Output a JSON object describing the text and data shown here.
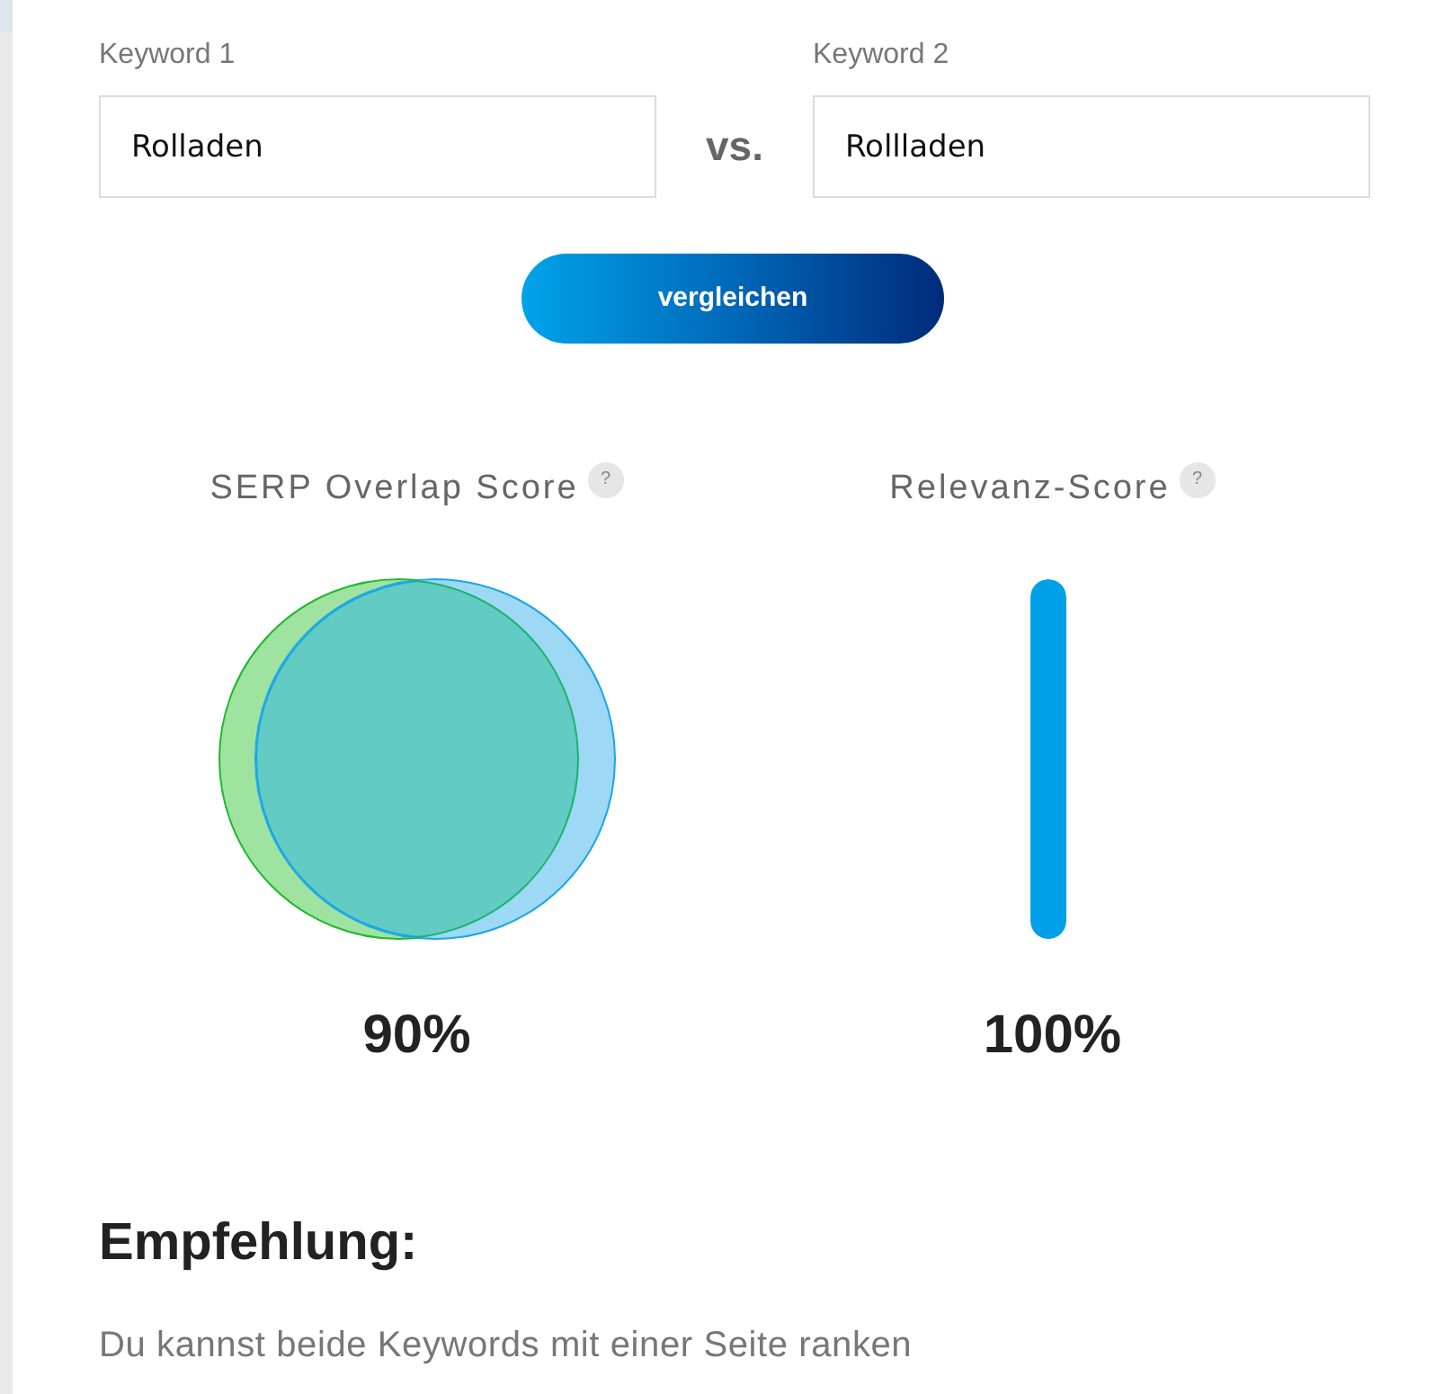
{
  "keyword_fields": [
    {
      "label": "Keyword 1",
      "value": "Rolladen"
    },
    {
      "label": "Keyword 2",
      "value": "Rollladen"
    }
  ],
  "separator": "vs.",
  "compare_button": "vergleichen",
  "scores": [
    {
      "kind": "venn",
      "title": "SERP Overlap Score",
      "help": "?",
      "reading": "90%"
    },
    {
      "kind": "bar",
      "title": "Relevanz-Score",
      "help": "?",
      "level": 1,
      "reading": "100%"
    }
  ],
  "recommendation": {
    "heading": "Empfehlung:",
    "text": "Du kannst beide Keywords mit einer Seite ranken"
  }
}
